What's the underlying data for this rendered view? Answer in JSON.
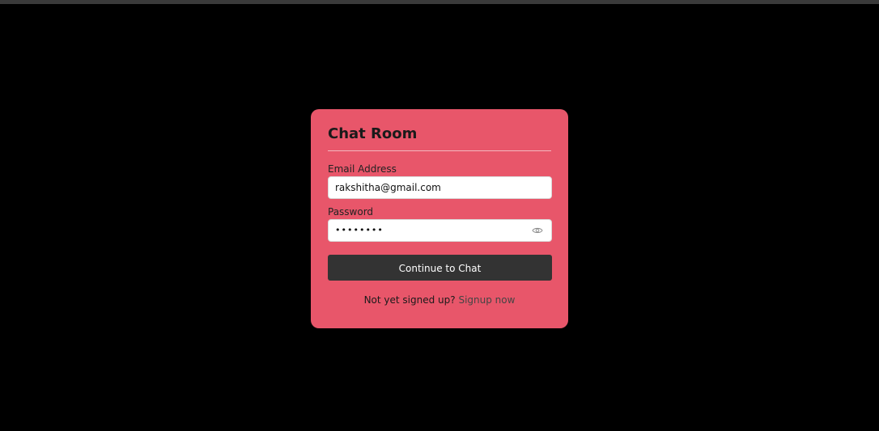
{
  "card": {
    "title": "Chat Room",
    "email_label": "Email Address",
    "email_value": "rakshitha@gmail.com",
    "password_label": "Password",
    "password_value": "••••••••",
    "submit_label": "Continue to Chat",
    "footer_text": "Not yet signed up?",
    "signup_link": "Signup now",
    "toggle_icon": "eye-icon"
  },
  "colors": {
    "background": "#000000",
    "card": "#e8566a",
    "button": "#333333"
  }
}
